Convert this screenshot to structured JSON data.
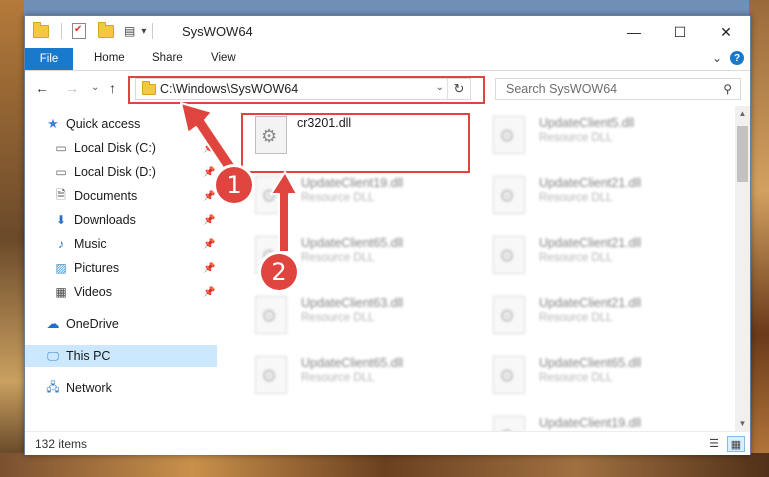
{
  "window": {
    "title": "SysWOW64",
    "controls": {
      "minimize": "—",
      "maximize": "☐",
      "close": "✕"
    }
  },
  "ribbon": {
    "tabs": [
      "File",
      "Home",
      "Share",
      "View"
    ],
    "expand": "⌄",
    "help": "?"
  },
  "nav": {
    "back": "←",
    "forward": "→",
    "recent": "⌄",
    "up": "↑",
    "address_path": "C:\\Windows\\SysWOW64",
    "address_dropdown": "⌄",
    "refresh": "↻",
    "search_placeholder": "Search SysWOW64"
  },
  "sidebar": {
    "items": [
      {
        "label": "Quick access",
        "icon": "star-icon",
        "pinned": false
      },
      {
        "label": "Local Disk (C:)",
        "icon": "drive-icon",
        "pinned": true
      },
      {
        "label": "Local Disk (D:)",
        "icon": "drive-icon",
        "pinned": true
      },
      {
        "label": "Documents",
        "icon": "documents-icon",
        "pinned": true
      },
      {
        "label": "Downloads",
        "icon": "downloads-icon",
        "pinned": true
      },
      {
        "label": "Music",
        "icon": "music-icon",
        "pinned": true
      },
      {
        "label": "Pictures",
        "icon": "pictures-icon",
        "pinned": true
      },
      {
        "label": "Videos",
        "icon": "videos-icon",
        "pinned": true
      },
      {
        "label": "OneDrive",
        "icon": "cloud-icon",
        "pinned": false
      },
      {
        "label": "This PC",
        "icon": "computer-icon",
        "pinned": false,
        "selected": true
      },
      {
        "label": "Network",
        "icon": "network-icon",
        "pinned": false
      }
    ]
  },
  "files": {
    "highlighted": {
      "name": "cr3201.dll",
      "type": ""
    },
    "column1": [
      {
        "name": "UpdateClient19.dll",
        "type": "Resource DLL"
      },
      {
        "name": "UpdateClient65.dll",
        "type": "Resource DLL"
      },
      {
        "name": "UpdateClient63.dll",
        "type": "Resource DLL"
      },
      {
        "name": "UpdateClient65.dll",
        "type": "Resource DLL"
      }
    ],
    "column2": [
      {
        "name": "UpdateClient5.dll",
        "type": "Resource DLL"
      },
      {
        "name": "UpdateClient21.dll",
        "type": "Resource DLL"
      },
      {
        "name": "UpdateClient21.dll",
        "type": "Resource DLL"
      },
      {
        "name": "UpdateClient21.dll",
        "type": "Resource DLL"
      },
      {
        "name": "UpdateClient65.dll",
        "type": "Resource DLL"
      },
      {
        "name": "UpdateClient19.dll",
        "type": "Resource DLL"
      }
    ]
  },
  "status": {
    "item_count": "132 items"
  },
  "callouts": [
    "1",
    "2"
  ],
  "colors": {
    "accent": "#1979ca",
    "highlight": "#e0443f",
    "selection": "#cce8ff"
  }
}
